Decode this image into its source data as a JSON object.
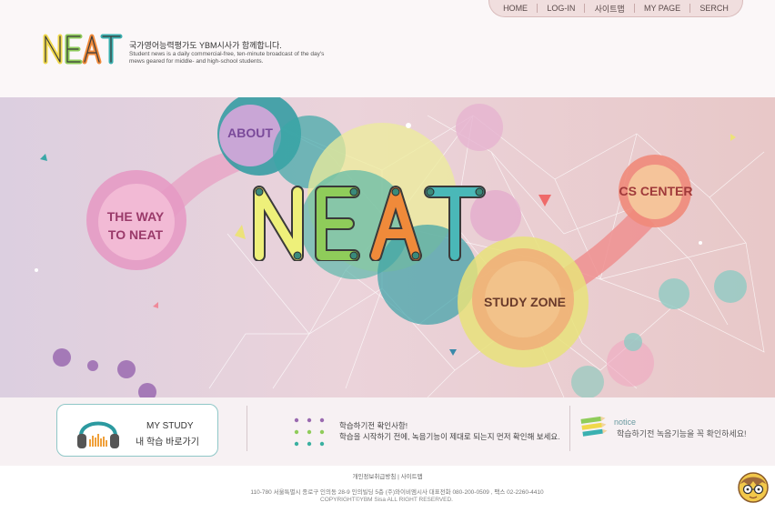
{
  "nav": {
    "items": [
      "HOME",
      "LOG-IN",
      "사이트맵",
      "MY PAGE",
      "SERCH"
    ]
  },
  "header": {
    "logo": "NEAT",
    "tagline": "국가영어능력평가도 YBM시사가 함께합니다.",
    "description": "Student news is a daily commercial-free, ten-minute broadcast of the day's mews geared for middle- and high-school students."
  },
  "hero": {
    "title": "NEAT",
    "bubbles": {
      "about": "ABOUT",
      "way_line1": "THE WAY",
      "way_line2": "TO NEAT",
      "cs": "CS CENTER",
      "study": "STUDY ZONE"
    }
  },
  "info": {
    "mystudy_title": "MY STUDY",
    "mystudy_sub": "내 학습 바로가기",
    "check_title": "학습하기전 확인사항!",
    "check_body": "학습을 시작하기 전에, 녹음기능이 제대로 되는지 먼저 확인해 보세요.",
    "notice_title": "notice",
    "notice_body": "학습하기전 녹음기능을 꼭 확인하세요!"
  },
  "footer": {
    "links": "개인정보취급방침  |  사이트맵",
    "address": "110-780 서울특별시 종로구 인의동 28-9 인의빌딩 5층 (주)와이비엠시사   대표전화 080-200-0509 , 팩스 02-2260-4410",
    "copyright": "COPYRIGHT©YBM Sisa ALL RIGHT RESERVED."
  },
  "colors": {
    "accent_teal": "#2c9aa0",
    "accent_pink": "#e07ab0",
    "accent_orange": "#f08a3a",
    "accent_yellow": "#e8e27a"
  }
}
